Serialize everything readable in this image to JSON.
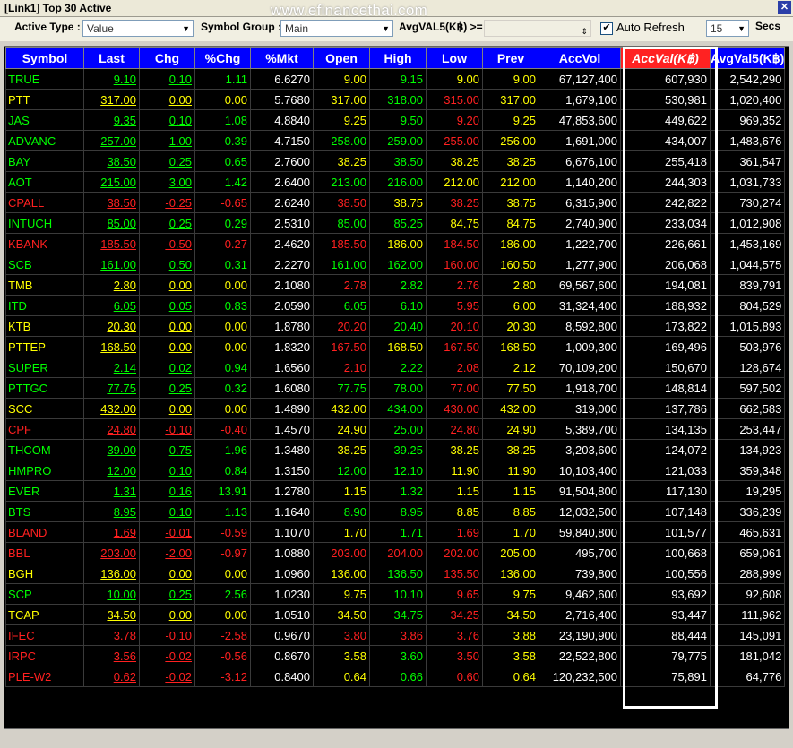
{
  "window": {
    "title": "[Link1] Top 30 Active",
    "watermark": "www.efinancethai.com"
  },
  "toolbar": {
    "active_type_label": "Active Type :",
    "active_type_value": "Value",
    "symbol_group_label": "Symbol Group :",
    "symbol_group_value": "Main",
    "avg_filter_label": "AvgVAL5(K฿) >=",
    "avg_filter_value": "",
    "auto_refresh_label": "Auto Refresh",
    "auto_refresh_checked": true,
    "interval_value": "15",
    "interval_unit": "Secs"
  },
  "table": {
    "columns": [
      "Symbol",
      "Last",
      "Chg",
      "%Chg",
      "%Mkt",
      "Open",
      "High",
      "Low",
      "Prev",
      "AccVol",
      "AccVal(K฿)",
      "AvgVal5(K฿)"
    ],
    "sorted_column_index": 10,
    "rows": [
      {
        "symbol": "TRUE",
        "last": "9.10",
        "chg": "0.10",
        "pchg": "1.11",
        "pmkt": "6.6270",
        "open": "9.00",
        "high": "9.15",
        "low": "9.00",
        "prev": "9.00",
        "accvol": "67,127,400",
        "accval": "607,930",
        "avgval5": "2,542,290",
        "c": {
          "sym": "g",
          "last": "g",
          "chg": "g",
          "pchg": "g",
          "open": "y",
          "high": "g",
          "low": "y",
          "prev": "y"
        }
      },
      {
        "symbol": "PTT",
        "last": "317.00",
        "chg": "0.00",
        "pchg": "0.00",
        "pmkt": "5.7680",
        "open": "317.00",
        "high": "318.00",
        "low": "315.00",
        "prev": "317.00",
        "accvol": "1,679,100",
        "accval": "530,981",
        "avgval5": "1,020,400",
        "c": {
          "sym": "y",
          "last": "y",
          "chg": "y",
          "pchg": "y",
          "open": "y",
          "high": "g",
          "low": "r",
          "prev": "y"
        }
      },
      {
        "symbol": "JAS",
        "last": "9.35",
        "chg": "0.10",
        "pchg": "1.08",
        "pmkt": "4.8840",
        "open": "9.25",
        "high": "9.50",
        "low": "9.20",
        "prev": "9.25",
        "accvol": "47,853,600",
        "accval": "449,622",
        "avgval5": "969,352",
        "c": {
          "sym": "g",
          "last": "g",
          "chg": "g",
          "pchg": "g",
          "open": "y",
          "high": "g",
          "low": "r",
          "prev": "y"
        }
      },
      {
        "symbol": "ADVANC",
        "last": "257.00",
        "chg": "1.00",
        "pchg": "0.39",
        "pmkt": "4.7150",
        "open": "258.00",
        "high": "259.00",
        "low": "255.00",
        "prev": "256.00",
        "accvol": "1,691,000",
        "accval": "434,007",
        "avgval5": "1,483,676",
        "c": {
          "sym": "g",
          "last": "g",
          "chg": "g",
          "pchg": "g",
          "open": "g",
          "high": "g",
          "low": "r",
          "prev": "y"
        }
      },
      {
        "symbol": "BAY",
        "last": "38.50",
        "chg": "0.25",
        "pchg": "0.65",
        "pmkt": "2.7600",
        "open": "38.25",
        "high": "38.50",
        "low": "38.25",
        "prev": "38.25",
        "accvol": "6,676,100",
        "accval": "255,418",
        "avgval5": "361,547",
        "c": {
          "sym": "g",
          "last": "g",
          "chg": "g",
          "pchg": "g",
          "open": "y",
          "high": "g",
          "low": "y",
          "prev": "y"
        }
      },
      {
        "symbol": "AOT",
        "last": "215.00",
        "chg": "3.00",
        "pchg": "1.42",
        "pmkt": "2.6400",
        "open": "213.00",
        "high": "216.00",
        "low": "212.00",
        "prev": "212.00",
        "accvol": "1,140,200",
        "accval": "244,303",
        "avgval5": "1,031,733",
        "c": {
          "sym": "g",
          "last": "g",
          "chg": "g",
          "pchg": "g",
          "open": "g",
          "high": "g",
          "low": "y",
          "prev": "y"
        }
      },
      {
        "symbol": "CPALL",
        "last": "38.50",
        "chg": "-0.25",
        "pchg": "-0.65",
        "pmkt": "2.6240",
        "open": "38.50",
        "high": "38.75",
        "low": "38.25",
        "prev": "38.75",
        "accvol": "6,315,900",
        "accval": "242,822",
        "avgval5": "730,274",
        "c": {
          "sym": "r",
          "last": "r",
          "chg": "r",
          "pchg": "r",
          "open": "r",
          "high": "y",
          "low": "r",
          "prev": "y"
        }
      },
      {
        "symbol": "INTUCH",
        "last": "85.00",
        "chg": "0.25",
        "pchg": "0.29",
        "pmkt": "2.5310",
        "open": "85.00",
        "high": "85.25",
        "low": "84.75",
        "prev": "84.75",
        "accvol": "2,740,900",
        "accval": "233,034",
        "avgval5": "1,012,908",
        "c": {
          "sym": "g",
          "last": "g",
          "chg": "g",
          "pchg": "g",
          "open": "g",
          "high": "g",
          "low": "y",
          "prev": "y"
        }
      },
      {
        "symbol": "KBANK",
        "last": "185.50",
        "chg": "-0.50",
        "pchg": "-0.27",
        "pmkt": "2.4620",
        "open": "185.50",
        "high": "186.00",
        "low": "184.50",
        "prev": "186.00",
        "accvol": "1,222,700",
        "accval": "226,661",
        "avgval5": "1,453,169",
        "c": {
          "sym": "r",
          "last": "r",
          "chg": "r",
          "pchg": "r",
          "open": "r",
          "high": "y",
          "low": "r",
          "prev": "y"
        }
      },
      {
        "symbol": "SCB",
        "last": "161.00",
        "chg": "0.50",
        "pchg": "0.31",
        "pmkt": "2.2270",
        "open": "161.00",
        "high": "162.00",
        "low": "160.00",
        "prev": "160.50",
        "accvol": "1,277,900",
        "accval": "206,068",
        "avgval5": "1,044,575",
        "c": {
          "sym": "g",
          "last": "g",
          "chg": "g",
          "pchg": "g",
          "open": "g",
          "high": "g",
          "low": "r",
          "prev": "y"
        }
      },
      {
        "symbol": "TMB",
        "last": "2.80",
        "chg": "0.00",
        "pchg": "0.00",
        "pmkt": "2.1080",
        "open": "2.78",
        "high": "2.82",
        "low": "2.76",
        "prev": "2.80",
        "accvol": "69,567,600",
        "accval": "194,081",
        "avgval5": "839,791",
        "c": {
          "sym": "y",
          "last": "y",
          "chg": "y",
          "pchg": "y",
          "open": "r",
          "high": "g",
          "low": "r",
          "prev": "y"
        }
      },
      {
        "symbol": "ITD",
        "last": "6.05",
        "chg": "0.05",
        "pchg": "0.83",
        "pmkt": "2.0590",
        "open": "6.05",
        "high": "6.10",
        "low": "5.95",
        "prev": "6.00",
        "accvol": "31,324,400",
        "accval": "188,932",
        "avgval5": "804,529",
        "c": {
          "sym": "g",
          "last": "g",
          "chg": "g",
          "pchg": "g",
          "open": "g",
          "high": "g",
          "low": "r",
          "prev": "y"
        }
      },
      {
        "symbol": "KTB",
        "last": "20.30",
        "chg": "0.00",
        "pchg": "0.00",
        "pmkt": "1.8780",
        "open": "20.20",
        "high": "20.40",
        "low": "20.10",
        "prev": "20.30",
        "accvol": "8,592,800",
        "accval": "173,822",
        "avgval5": "1,015,893",
        "c": {
          "sym": "y",
          "last": "y",
          "chg": "y",
          "pchg": "y",
          "open": "r",
          "high": "g",
          "low": "r",
          "prev": "y"
        }
      },
      {
        "symbol": "PTTEP",
        "last": "168.50",
        "chg": "0.00",
        "pchg": "0.00",
        "pmkt": "1.8320",
        "open": "167.50",
        "high": "168.50",
        "low": "167.50",
        "prev": "168.50",
        "accvol": "1,009,300",
        "accval": "169,496",
        "avgval5": "503,976",
        "c": {
          "sym": "y",
          "last": "y",
          "chg": "y",
          "pchg": "y",
          "open": "r",
          "high": "y",
          "low": "r",
          "prev": "y"
        }
      },
      {
        "symbol": "SUPER",
        "last": "2.14",
        "chg": "0.02",
        "pchg": "0.94",
        "pmkt": "1.6560",
        "open": "2.10",
        "high": "2.22",
        "low": "2.08",
        "prev": "2.12",
        "accvol": "70,109,200",
        "accval": "150,670",
        "avgval5": "128,674",
        "c": {
          "sym": "g",
          "last": "g",
          "chg": "g",
          "pchg": "g",
          "open": "r",
          "high": "g",
          "low": "r",
          "prev": "y"
        }
      },
      {
        "symbol": "PTTGC",
        "last": "77.75",
        "chg": "0.25",
        "pchg": "0.32",
        "pmkt": "1.6080",
        "open": "77.75",
        "high": "78.00",
        "low": "77.00",
        "prev": "77.50",
        "accvol": "1,918,700",
        "accval": "148,814",
        "avgval5": "597,502",
        "c": {
          "sym": "g",
          "last": "g",
          "chg": "g",
          "pchg": "g",
          "open": "g",
          "high": "g",
          "low": "r",
          "prev": "y"
        }
      },
      {
        "symbol": "SCC",
        "last": "432.00",
        "chg": "0.00",
        "pchg": "0.00",
        "pmkt": "1.4890",
        "open": "432.00",
        "high": "434.00",
        "low": "430.00",
        "prev": "432.00",
        "accvol": "319,000",
        "accval": "137,786",
        "avgval5": "662,583",
        "c": {
          "sym": "y",
          "last": "y",
          "chg": "y",
          "pchg": "y",
          "open": "y",
          "high": "g",
          "low": "r",
          "prev": "y"
        }
      },
      {
        "symbol": "CPF",
        "last": "24.80",
        "chg": "-0.10",
        "pchg": "-0.40",
        "pmkt": "1.4570",
        "open": "24.90",
        "high": "25.00",
        "low": "24.80",
        "prev": "24.90",
        "accvol": "5,389,700",
        "accval": "134,135",
        "avgval5": "253,447",
        "c": {
          "sym": "r",
          "last": "r",
          "chg": "r",
          "pchg": "r",
          "open": "y",
          "high": "g",
          "low": "r",
          "prev": "y"
        }
      },
      {
        "symbol": "THCOM",
        "last": "39.00",
        "chg": "0.75",
        "pchg": "1.96",
        "pmkt": "1.3480",
        "open": "38.25",
        "high": "39.25",
        "low": "38.25",
        "prev": "38.25",
        "accvol": "3,203,600",
        "accval": "124,072",
        "avgval5": "134,923",
        "c": {
          "sym": "g",
          "last": "g",
          "chg": "g",
          "pchg": "g",
          "open": "y",
          "high": "g",
          "low": "y",
          "prev": "y"
        }
      },
      {
        "symbol": "HMPRO",
        "last": "12.00",
        "chg": "0.10",
        "pchg": "0.84",
        "pmkt": "1.3150",
        "open": "12.00",
        "high": "12.10",
        "low": "11.90",
        "prev": "11.90",
        "accvol": "10,103,400",
        "accval": "121,033",
        "avgval5": "359,348",
        "c": {
          "sym": "g",
          "last": "g",
          "chg": "g",
          "pchg": "g",
          "open": "g",
          "high": "g",
          "low": "y",
          "prev": "y"
        }
      },
      {
        "symbol": "EVER",
        "last": "1.31",
        "chg": "0.16",
        "pchg": "13.91",
        "pmkt": "1.2780",
        "open": "1.15",
        "high": "1.32",
        "low": "1.15",
        "prev": "1.15",
        "accvol": "91,504,800",
        "accval": "117,130",
        "avgval5": "19,295",
        "c": {
          "sym": "g",
          "last": "g",
          "chg": "g",
          "pchg": "g",
          "open": "y",
          "high": "g",
          "low": "y",
          "prev": "y"
        }
      },
      {
        "symbol": "BTS",
        "last": "8.95",
        "chg": "0.10",
        "pchg": "1.13",
        "pmkt": "1.1640",
        "open": "8.90",
        "high": "8.95",
        "low": "8.85",
        "prev": "8.85",
        "accvol": "12,032,500",
        "accval": "107,148",
        "avgval5": "336,239",
        "c": {
          "sym": "g",
          "last": "g",
          "chg": "g",
          "pchg": "g",
          "open": "g",
          "high": "g",
          "low": "y",
          "prev": "y"
        }
      },
      {
        "symbol": "BLAND",
        "last": "1.69",
        "chg": "-0.01",
        "pchg": "-0.59",
        "pmkt": "1.1070",
        "open": "1.70",
        "high": "1.71",
        "low": "1.69",
        "prev": "1.70",
        "accvol": "59,840,800",
        "accval": "101,577",
        "avgval5": "465,631",
        "c": {
          "sym": "r",
          "last": "r",
          "chg": "r",
          "pchg": "r",
          "open": "y",
          "high": "g",
          "low": "r",
          "prev": "y"
        }
      },
      {
        "symbol": "BBL",
        "last": "203.00",
        "chg": "-2.00",
        "pchg": "-0.97",
        "pmkt": "1.0880",
        "open": "203.00",
        "high": "204.00",
        "low": "202.00",
        "prev": "205.00",
        "accvol": "495,700",
        "accval": "100,668",
        "avgval5": "659,061",
        "c": {
          "sym": "r",
          "last": "r",
          "chg": "r",
          "pchg": "r",
          "open": "r",
          "high": "r",
          "low": "r",
          "prev": "y"
        }
      },
      {
        "symbol": "BGH",
        "last": "136.00",
        "chg": "0.00",
        "pchg": "0.00",
        "pmkt": "1.0960",
        "open": "136.00",
        "high": "136.50",
        "low": "135.50",
        "prev": "136.00",
        "accvol": "739,800",
        "accval": "100,556",
        "avgval5": "288,999",
        "c": {
          "sym": "y",
          "last": "y",
          "chg": "y",
          "pchg": "y",
          "open": "y",
          "high": "g",
          "low": "r",
          "prev": "y"
        }
      },
      {
        "symbol": "SCP",
        "last": "10.00",
        "chg": "0.25",
        "pchg": "2.56",
        "pmkt": "1.0230",
        "open": "9.75",
        "high": "10.10",
        "low": "9.65",
        "prev": "9.75",
        "accvol": "9,462,600",
        "accval": "93,692",
        "avgval5": "92,608",
        "c": {
          "sym": "g",
          "last": "g",
          "chg": "g",
          "pchg": "g",
          "open": "y",
          "high": "g",
          "low": "r",
          "prev": "y"
        }
      },
      {
        "symbol": "TCAP",
        "last": "34.50",
        "chg": "0.00",
        "pchg": "0.00",
        "pmkt": "1.0510",
        "open": "34.50",
        "high": "34.75",
        "low": "34.25",
        "prev": "34.50",
        "accvol": "2,716,400",
        "accval": "93,447",
        "avgval5": "111,962",
        "c": {
          "sym": "y",
          "last": "y",
          "chg": "y",
          "pchg": "y",
          "open": "y",
          "high": "g",
          "low": "r",
          "prev": "y"
        }
      },
      {
        "symbol": "IFEC",
        "last": "3.78",
        "chg": "-0.10",
        "pchg": "-2.58",
        "pmkt": "0.9670",
        "open": "3.80",
        "high": "3.86",
        "low": "3.76",
        "prev": "3.88",
        "accvol": "23,190,900",
        "accval": "88,444",
        "avgval5": "145,091",
        "c": {
          "sym": "r",
          "last": "r",
          "chg": "r",
          "pchg": "r",
          "open": "r",
          "high": "r",
          "low": "r",
          "prev": "y"
        }
      },
      {
        "symbol": "IRPC",
        "last": "3.56",
        "chg": "-0.02",
        "pchg": "-0.56",
        "pmkt": "0.8670",
        "open": "3.58",
        "high": "3.60",
        "low": "3.50",
        "prev": "3.58",
        "accvol": "22,522,800",
        "accval": "79,775",
        "avgval5": "181,042",
        "c": {
          "sym": "r",
          "last": "r",
          "chg": "r",
          "pchg": "r",
          "open": "y",
          "high": "g",
          "low": "r",
          "prev": "y"
        }
      },
      {
        "symbol": "PLE-W2",
        "last": "0.62",
        "chg": "-0.02",
        "pchg": "-3.12",
        "pmkt": "0.8400",
        "open": "0.64",
        "high": "0.66",
        "low": "0.60",
        "prev": "0.64",
        "accvol": "120,232,500",
        "accval": "75,891",
        "avgval5": "64,776",
        "c": {
          "sym": "r",
          "last": "r",
          "chg": "r",
          "pchg": "r",
          "open": "y",
          "high": "g",
          "low": "r",
          "prev": "y"
        }
      }
    ]
  }
}
